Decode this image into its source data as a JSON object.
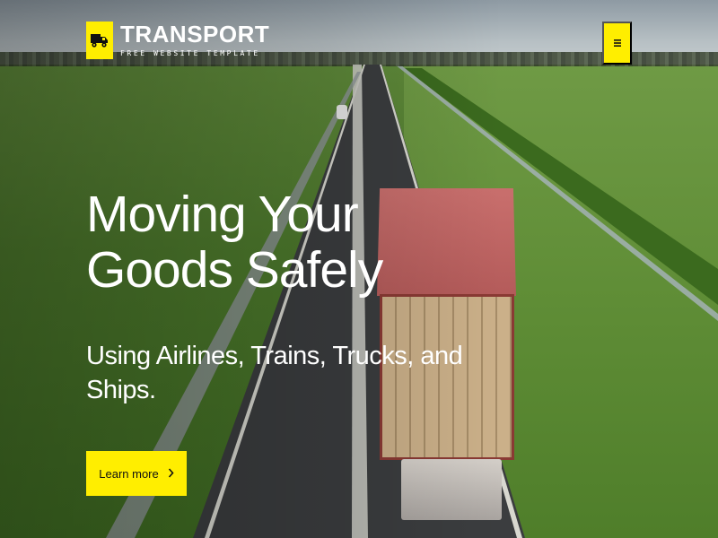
{
  "header": {
    "logo_icon": "truck-icon",
    "title": "TRANSPORT",
    "subtitle": "FREE WEBSITE TEMPLATE",
    "menu_icon": "hamburger-menu-icon"
  },
  "hero": {
    "headline": "Moving Your Goods Safely",
    "subheadline": "Using Airlines, Trains, Trucks, and Ships.",
    "cta_label": "Learn more",
    "cta_icon": "chevron-right-icon"
  },
  "colors": {
    "accent": "#ffee00",
    "text": "#ffffff",
    "button_text": "#111111"
  }
}
